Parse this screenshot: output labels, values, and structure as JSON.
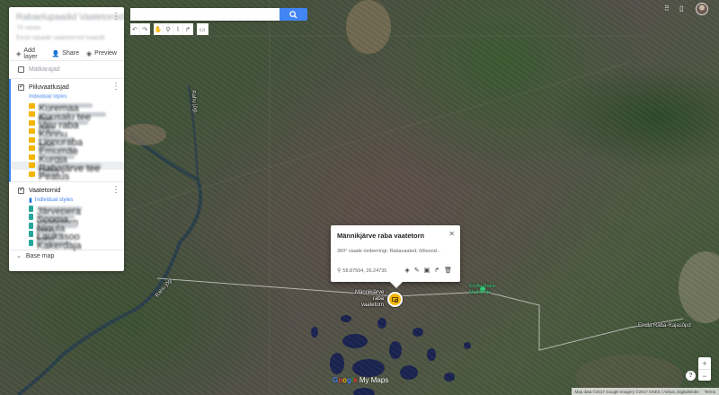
{
  "panel": {
    "title": "Rabaelupaadid Vaatetornid",
    "views": "70 views",
    "description": "Eesti rabade vaatetornid kaardil",
    "add_layer": "Add layer",
    "share": "Share",
    "preview": "Preview",
    "layer0": {
      "name": "Matkarajad",
      "checked": false
    },
    "layer1": {
      "name": "Piiluvaatlusjad",
      "styles": "Individual styles",
      "items": [
        "Kuremaa tee",
        "Kuusalu tee piiri",
        "Viru raba",
        "Kõnnu soo",
        "Linnuraba",
        "Emumäe",
        "Kurgja raba",
        "Rabajärve tee",
        "Peatus"
      ]
    },
    "layer2": {
      "name": "Vaatetornid",
      "styles": "Individual styles",
      "items": [
        "Järvepera vaatetorn",
        "Sooma torn",
        "Nigula torn",
        "Laukasoo",
        "Kakerdaja"
      ]
    },
    "base_map": "Base map"
  },
  "search": {
    "placeholder": ""
  },
  "info": {
    "title": "Männikjärve raba vaatetorn",
    "description": "360° vaade ümberringi; Rabavaated; õõtsood...",
    "coords": "58.87564, 26.24735"
  },
  "marker_label": "Männikjärve raba vaatetorn",
  "poi_label": "Endla Raba-Matkaraja",
  "road_label": "Endla Raba-Rajasõpd",
  "river_labels": [
    "Rahu jõgi",
    "Rahu jõgi"
  ],
  "logo": {
    "g1": "G",
    "g2": "o",
    "g3": "o",
    "g1b": "g",
    "g4": "l",
    "g2b": "e",
    "mymaps": " My Maps"
  },
  "attribution": {
    "data": "Map data ©2017 Google Imagery ©2017 CNES / Airbus, DigitalGlobe",
    "terms": "Terms"
  },
  "zoom": {
    "in": "+",
    "out": "−"
  },
  "help": "?",
  "colors": {
    "accent": "#4285f4",
    "marker": "#f4b400",
    "poi": "#34d17a",
    "layer_icon_yellow": "#f4b400",
    "layer_icon_teal": "#26a69a"
  }
}
